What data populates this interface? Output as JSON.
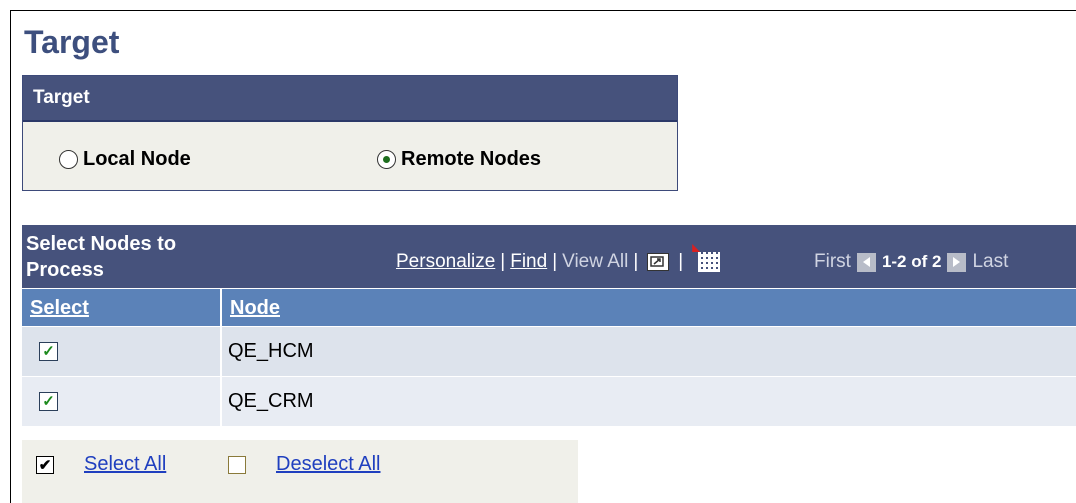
{
  "page": {
    "title": "Target"
  },
  "target_group": {
    "header": "Target",
    "options": [
      {
        "label": "Local Node",
        "selected": false
      },
      {
        "label": "Remote Nodes",
        "selected": true
      }
    ]
  },
  "grid": {
    "title": "Select Nodes to Process",
    "nav": {
      "personalize": "Personalize",
      "find": "Find",
      "view_all": "View All",
      "sep": "|"
    },
    "pager": {
      "first": "First",
      "count": "1-2 of 2",
      "last": "Last"
    },
    "columns": [
      "Select",
      "Node"
    ],
    "rows": [
      {
        "checked": true,
        "node": "QE_HCM",
        "mark": "✓"
      },
      {
        "checked": true,
        "node": "QE_CRM",
        "mark": "✓"
      }
    ]
  },
  "footer": {
    "select_all": "Select All",
    "deselect_all": "Deselect All",
    "check_mark": "✔"
  },
  "colors": {
    "title": "#3d4f7e",
    "header_bg": "#46527c",
    "column_header_bg": "#5b82b8",
    "link": "#1f3fbf"
  }
}
